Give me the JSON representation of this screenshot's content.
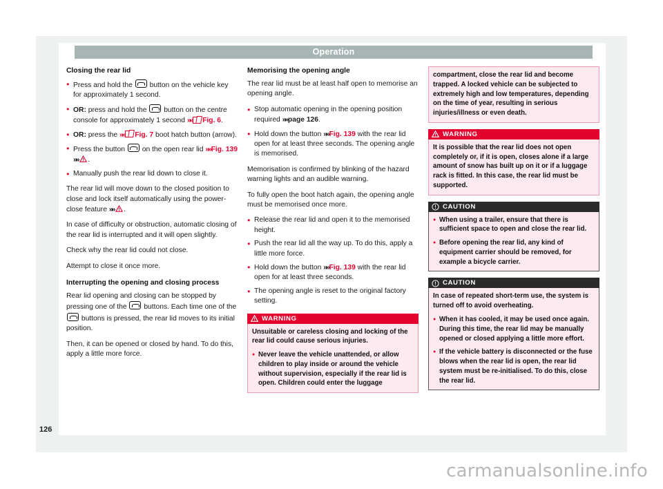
{
  "header": {
    "title": "Operation"
  },
  "page_number": "126",
  "watermark": "carmanualsonline.info",
  "colors": {
    "accent_red": "#e3032e",
    "header_band": "#a7b5b4",
    "warning_header": "#e3032e",
    "caution_header": "#2b2b2b",
    "box_body": "#fdeaef",
    "page_backdrop": "#eef1f2"
  },
  "left_column": {
    "heading_1": "Closing the rear lid",
    "bullets_1": [
      {
        "prefix": "",
        "text_a": "Press and hold the ",
        "icon": "rear-lid-button-icon",
        "text_b": " button on the vehicle key for approximately 1 second."
      },
      {
        "prefix": "OR:",
        "text_a": " press and hold the ",
        "icon": "rear-lid-button-icon",
        "text_b": " button on the centre console for approximately 1 second ",
        "arrow": "»»",
        "fig_icon": "figure-reference-icon",
        "fig": "Fig. 6",
        "tail": "."
      },
      {
        "prefix": "OR:",
        "text_a": " press the ",
        "arrow": "»»",
        "fig_icon": "figure-reference-icon",
        "fig": "Fig. 7",
        "text_b": " boot hatch button (arrow)."
      },
      {
        "prefix": "",
        "text_a": "Press the button ",
        "icon": "rear-lid-button-icon",
        "text_b": " on the open rear lid ",
        "arrow": "»»",
        "fig": "Fig. 139",
        "arrow2": "»»",
        "warn_icon": "warning-triangle-icon",
        "tail": "."
      },
      {
        "prefix": "",
        "text_a": "Manually push the rear lid down to close it."
      }
    ],
    "para_1_a": "The rear lid will move down to the closed position to close and lock itself automatically using the power-close feature ",
    "para_1_warn_icon": "warning-triangle-icon",
    "para_1_b": ".",
    "para_2": "In case of difficulty or obstruction, automatic closing of the rear lid is interrupted and it will open slightly.",
    "para_3": "Check why the rear lid could not close.",
    "para_4": "Attempt to close it once more.",
    "heading_2": "Interrupting the opening and closing process",
    "para_5_a": "Rear lid opening and closing can be stopped by pressing one of the ",
    "para_5_b": " buttons. Each time one of the ",
    "para_5_c": " buttons is pressed, the rear lid moves to its initial position.",
    "para_6": "Then, it can be opened or closed by hand. To do this, apply a little more force."
  },
  "middle_column": {
    "heading_1": "Memorising the opening angle",
    "para_1": "The rear lid must be at least half open to memorise an opening angle.",
    "bullets_1": [
      {
        "text_a": "Stop automatic opening in the opening position required ",
        "arrow": "»»",
        "ref": "page 126",
        "tail": "."
      },
      {
        "text_a": "Hold down the button ",
        "arrow": "»»",
        "fig": "Fig. 139",
        "text_b": " with the rear lid open for at least three seconds. The opening angle is memorised."
      }
    ],
    "para_2": "Memorisation is confirmed by blinking of the hazard warning lights and an audible warning.",
    "para_3": "To fully open the boot hatch again, the opening angle must be memorised once more.",
    "bullets_2": [
      {
        "text_a": "Release the rear lid and open it to the memorised height."
      },
      {
        "text_a": "Push the rear lid all the way up. To do this, apply a little more force."
      },
      {
        "text_a": "Hold down the button ",
        "arrow": "»»",
        "fig": "Fig. 139",
        "text_b": " with the rear lid open for at least three seconds."
      },
      {
        "text_a": "The opening angle is reset to the original factory setting."
      }
    ],
    "warning_box": {
      "icon": "warning-triangle-icon",
      "label": "WARNING",
      "paragraphs": [
        "Unsuitable or careless closing and locking of the rear lid could cause serious injuries."
      ],
      "bullets": [
        "Never leave the vehicle unattended, or allow children to play inside or around the vehicle without supervision, especially if the rear lid is open. Children could enter the luggage"
      ]
    }
  },
  "right_column": {
    "continuation_box": {
      "paragraphs": [
        "compartment, close the rear lid and become trapped. A locked vehicle can be subjected to extremely high and low temperatures, depending on the time of year, resulting in serious injuries/illness or even death."
      ]
    },
    "warning_box": {
      "icon": "warning-triangle-icon",
      "label": "WARNING",
      "paragraphs": [
        "It is possible that the rear lid does not open completely or, if it is open, closes alone if a large amount of snow has built up on it or if a luggage rack is fitted. In this case, the rear lid must be supported."
      ]
    },
    "caution_box_1": {
      "icon": "caution-circle-icon",
      "label": "CAUTION",
      "bullets": [
        "When using a trailer, ensure that there is sufficient space to open and close the rear lid.",
        "Before opening the rear lid, any kind of equipment carrier should be removed, for example a bicycle carrier."
      ]
    },
    "caution_box_2": {
      "icon": "caution-circle-icon",
      "label": "CAUTION",
      "paragraphs": [
        "In case of repeated short-term use, the system is turned off to avoid overheating."
      ],
      "bullets": [
        "When it has cooled, it may be used once again. During this time, the rear lid may be manually opened or closed applying a little more effort.",
        "If the vehicle battery is disconnected or the fuse blows when the rear lid is open, the rear lid system must be re-initialised. To do this, close the rear lid."
      ]
    }
  }
}
